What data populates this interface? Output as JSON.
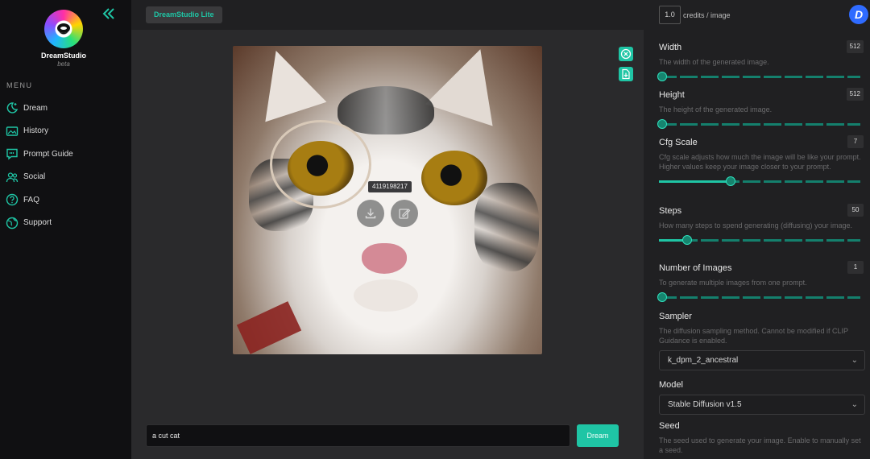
{
  "sidebar": {
    "logo_title": "DreamStudio",
    "logo_subtitle": "beta",
    "menu_label": "MENU",
    "items": [
      {
        "label": "Dream",
        "icon": "moon-sparkle-icon"
      },
      {
        "label": "History",
        "icon": "image-gallery-icon"
      },
      {
        "label": "Prompt Guide",
        "icon": "chat-quote-icon"
      },
      {
        "label": "Social",
        "icon": "people-icon"
      },
      {
        "label": "FAQ",
        "icon": "question-circle-icon"
      },
      {
        "label": "Support",
        "icon": "globe-icon"
      }
    ]
  },
  "topbar": {
    "brand_badge": "DreamStudio Lite",
    "credits_value": "1.0",
    "credits_label": "credits / image",
    "avatar_letter": "D"
  },
  "main": {
    "seed_tag": "4119198217",
    "prompt_value": "a cut cat",
    "dream_button": "Dream"
  },
  "panel": {
    "width": {
      "title": "Width",
      "value": "512",
      "desc": "The width of the generated image.",
      "level": 0
    },
    "height": {
      "title": "Height",
      "value": "512",
      "desc": "The height of the generated image.",
      "level": 0
    },
    "cfg": {
      "title": "Cfg Scale",
      "value": "7",
      "desc": "Cfg scale adjusts how much the image will be like your prompt. Higher values keep your image closer to your prompt.",
      "level": 0.35
    },
    "steps": {
      "title": "Steps",
      "value": "50",
      "desc": "How many steps to spend generating (diffusing) your image.",
      "level": 0.13
    },
    "num_images": {
      "title": "Number of Images",
      "value": "1",
      "desc": "To generate multiple images from one prompt.",
      "level": 0
    },
    "sampler": {
      "title": "Sampler",
      "desc": "The diffusion sampling method. Cannot be modified if CLIP Guidance is enabled.",
      "selected": "k_dpm_2_ancestral"
    },
    "model": {
      "title": "Model",
      "selected": "Stable Diffusion v1.5"
    },
    "seed": {
      "title": "Seed",
      "desc": "The seed used to generate your image. Enable to manually set a seed."
    }
  },
  "colors": {
    "accent": "#1fc5a5",
    "sidebar_bg": "#101012",
    "panel_bg": "#202022",
    "avatar": "#2f6bff"
  }
}
